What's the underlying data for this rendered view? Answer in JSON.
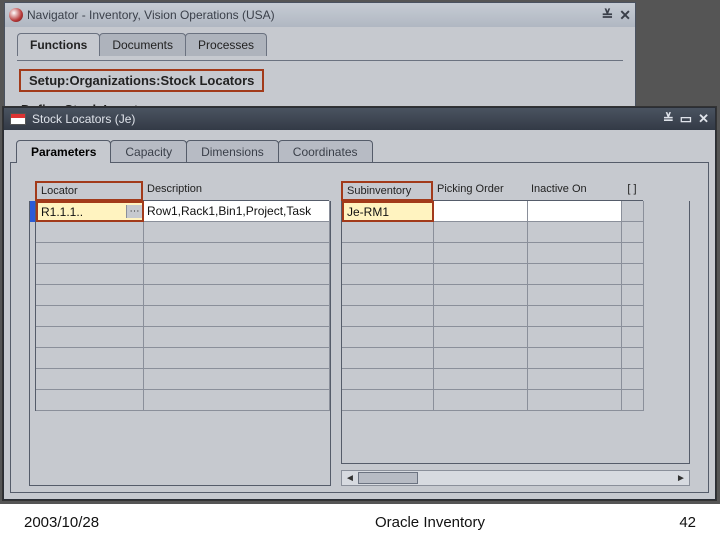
{
  "nav": {
    "title": "Navigator - Inventory, Vision Operations (USA)",
    "tabs": [
      "Functions",
      "Documents",
      "Processes"
    ],
    "breadcrumb": "Setup:Organizations:Stock Locators",
    "subtitle": "Define Stock Locators"
  },
  "sl": {
    "title": "Stock Locators (Je)",
    "tabs": [
      "Parameters",
      "Capacity",
      "Dimensions",
      "Coordinates"
    ],
    "columns_left": [
      "Locator",
      "Description"
    ],
    "columns_right": [
      "Subinventory",
      "Picking Order",
      "Inactive On",
      "[  ]"
    ],
    "rows": [
      {
        "locator": "R1.1.1..",
        "description": "Row1,Rack1,Bin1,Project,Task",
        "subinventory": "Je-RM1",
        "picking_order": "",
        "inactive_on": ""
      }
    ],
    "blank_rows": 9
  },
  "footer": {
    "date": "2003/10/28",
    "center": "Oracle Inventory",
    "page": "42"
  }
}
